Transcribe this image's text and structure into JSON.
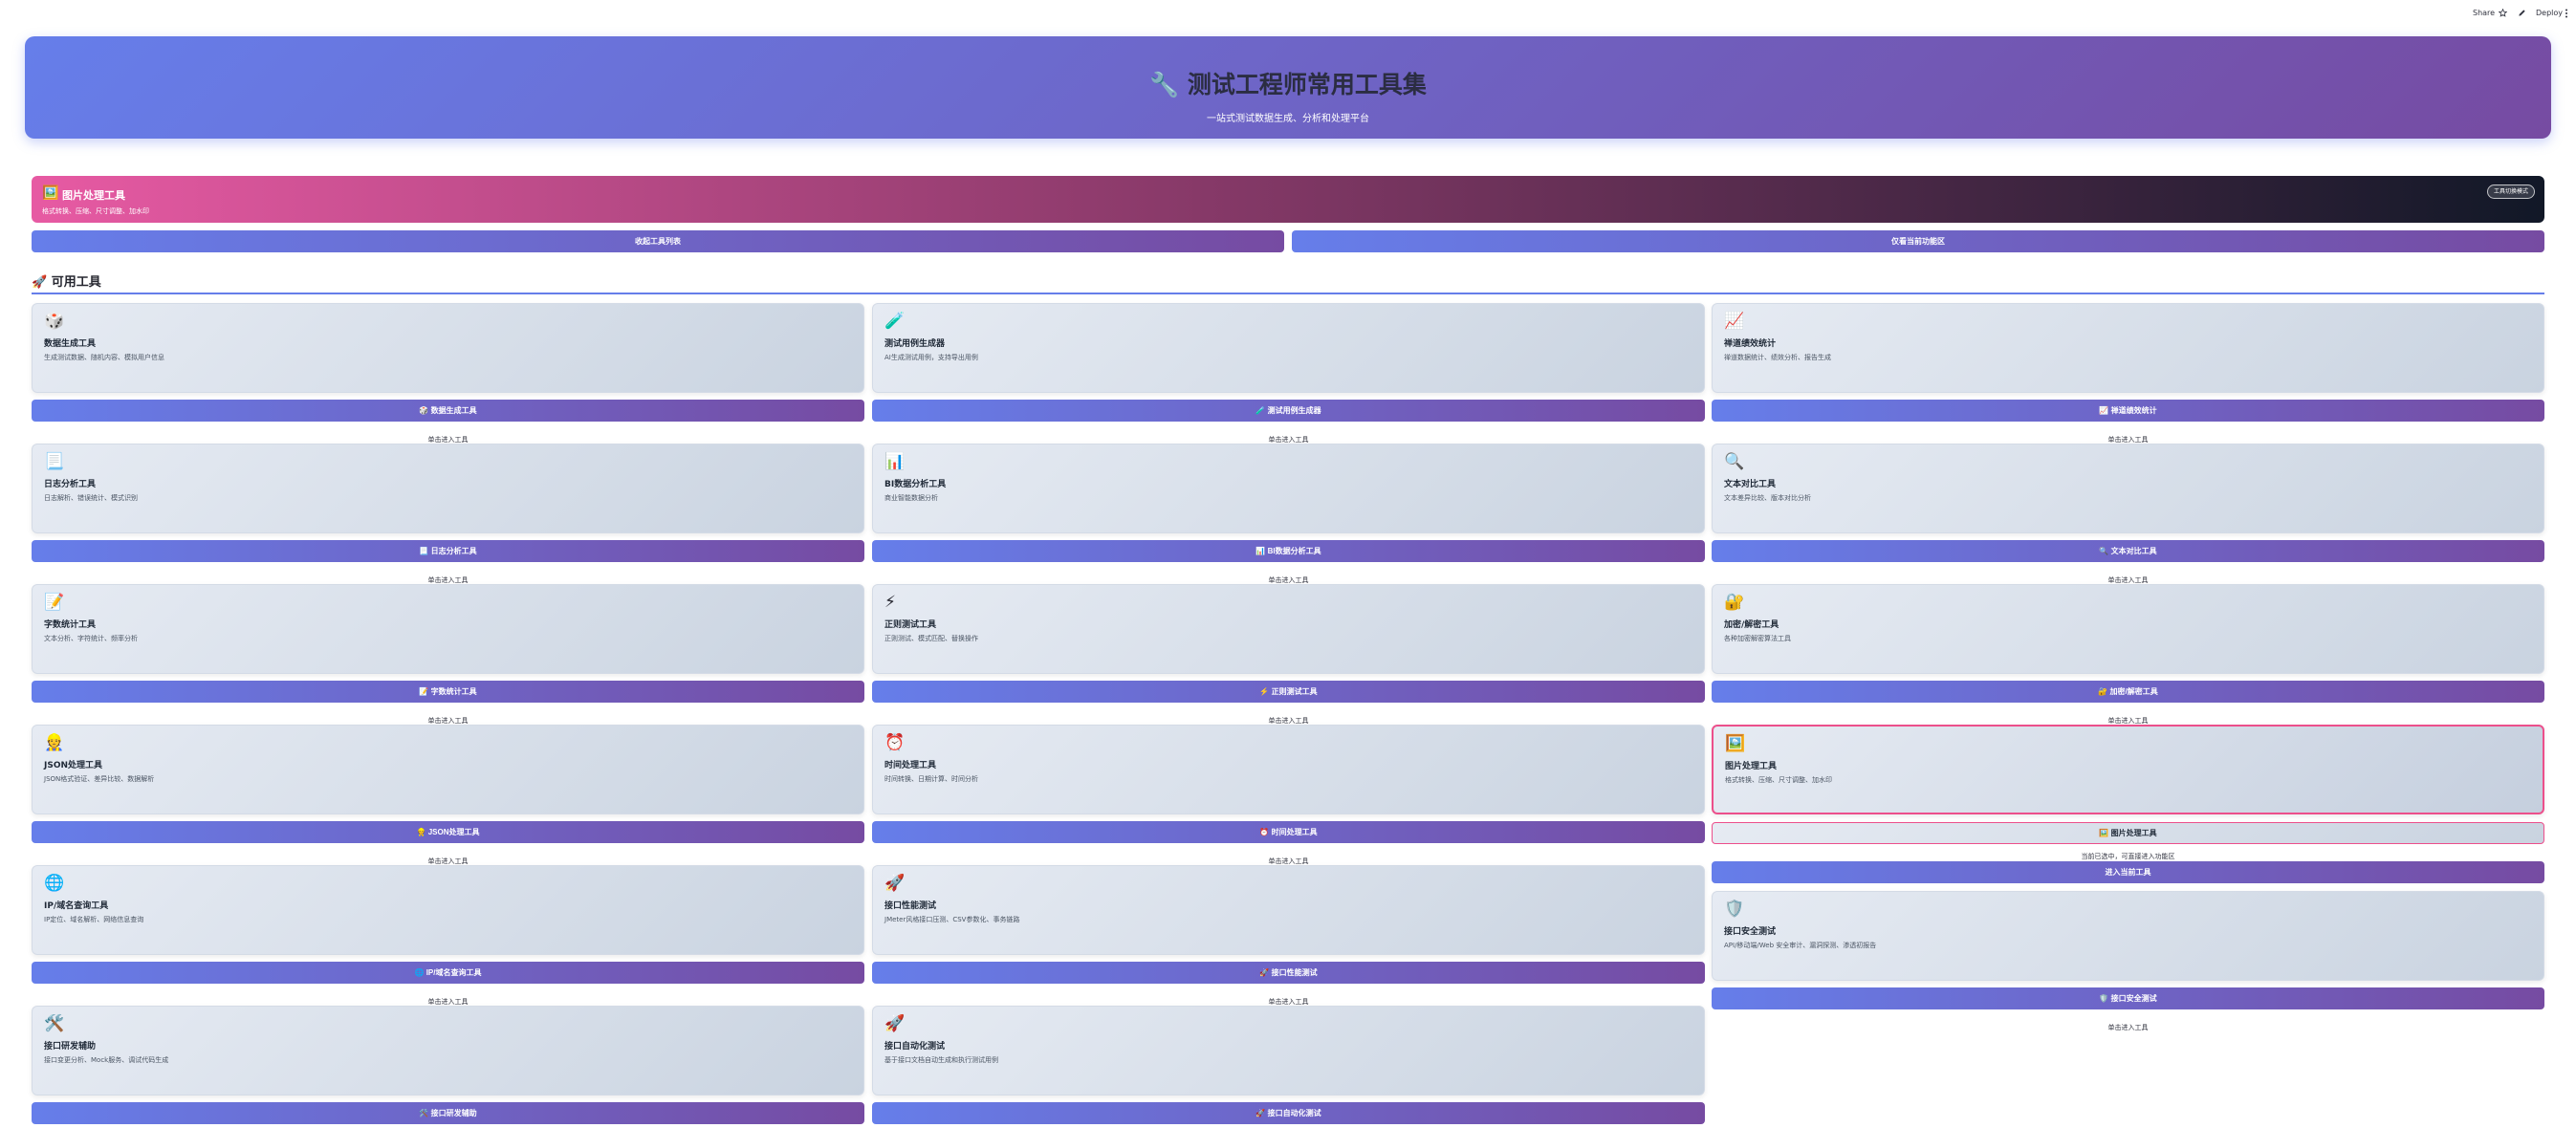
{
  "toolbar": {
    "share_label": "Share",
    "deploy_label": "Deploy"
  },
  "hero": {
    "icon": "🔧",
    "title": "测试工程师常用工具集",
    "subtitle": "一站式测试数据生成、分析和处理平台"
  },
  "active_tool": {
    "icon": "🖼️",
    "name": "图片处理工具",
    "description": "格式转换、压缩、尺寸调整、加水印",
    "badge": "工具切换模式"
  },
  "mode_buttons": {
    "collapse_label": "收起工具列表",
    "only_active_label": "仅看当前功能区"
  },
  "section": {
    "icon": "🚀",
    "title": "可用工具"
  },
  "hint_text": "单击进入工具",
  "selected_hint_text": "当前已选中，可直接进入功能区",
  "enter_current_label": "进入当前工具",
  "tools": [
    {
      "icon": "🎲",
      "name": "数据生成工具",
      "desc": "生成测试数据、随机内容、模拟用户信息",
      "button": "🎲 数据生成工具"
    },
    {
      "icon": "🧪",
      "name": "测试用例生成器",
      "desc": "AI生成测试用例，支持导出用例",
      "button": "🧪 测试用例生成器"
    },
    {
      "icon": "📈",
      "name": "禅道绩效统计",
      "desc": "禅道数据统计、绩效分析、报告生成",
      "button": "📈 禅道绩效统计"
    },
    {
      "icon": "📃",
      "name": "日志分析工具",
      "desc": "日志解析、错误统计、模式识别",
      "button": "📃 日志分析工具"
    },
    {
      "icon": "📊",
      "name": "BI数据分析工具",
      "desc": "商业智能数据分析",
      "button": "📊 BI数据分析工具"
    },
    {
      "icon": "🔍",
      "name": "文本对比工具",
      "desc": "文本差异比较、版本对比分析",
      "button": "🔍 文本对比工具"
    },
    {
      "icon": "📝",
      "name": "字数统计工具",
      "desc": "文本分析、字符统计、频率分析",
      "button": "📝 字数统计工具"
    },
    {
      "icon": "⚡",
      "name": "正则测试工具",
      "desc": "正则测试、模式匹配、替换操作",
      "button": "⚡ 正则测试工具"
    },
    {
      "icon": "🔐",
      "name": "加密/解密工具",
      "desc": "各种加密解密算法工具",
      "button": "🔐 加密/解密工具"
    },
    {
      "icon": "👷",
      "name": "JSON处理工具",
      "desc": "JSON格式验证、差异比较、数据解析",
      "button": "👷 JSON处理工具"
    },
    {
      "icon": "⏰",
      "name": "时间处理工具",
      "desc": "时间转换、日期计算、时间分析",
      "button": "⏰ 时间处理工具"
    },
    {
      "icon": "🖼️",
      "name": "图片处理工具",
      "desc": "格式转换、压缩、尺寸调整、加水印",
      "button": "🖼️ 图片处理工具"
    },
    {
      "icon": "🌐",
      "name": "IP/域名查询工具",
      "desc": "IP定位、域名解析、网络信息查询",
      "button": "🌐 IP/域名查询工具"
    },
    {
      "icon": "🚀",
      "name": "接口性能测试",
      "desc": "JMeter风格接口压测、CSV参数化、事务链路",
      "button": "🚀 接口性能测试"
    },
    {
      "icon": "🛡️",
      "name": "接口安全测试",
      "desc": "API/移动端/Web 安全审计、漏洞探测、渗透初报告",
      "button": "🛡️ 接口安全测试"
    },
    {
      "icon": "🛠️",
      "name": "接口研发辅助",
      "desc": "接口变更分析、Mock服务、调试代码生成",
      "button": "🛠️ 接口研发辅助"
    },
    {
      "icon": "🚀",
      "name": "接口自动化测试",
      "desc": "基于接口文档自动生成和执行测试用例",
      "button": "🚀 接口自动化测试"
    }
  ]
}
